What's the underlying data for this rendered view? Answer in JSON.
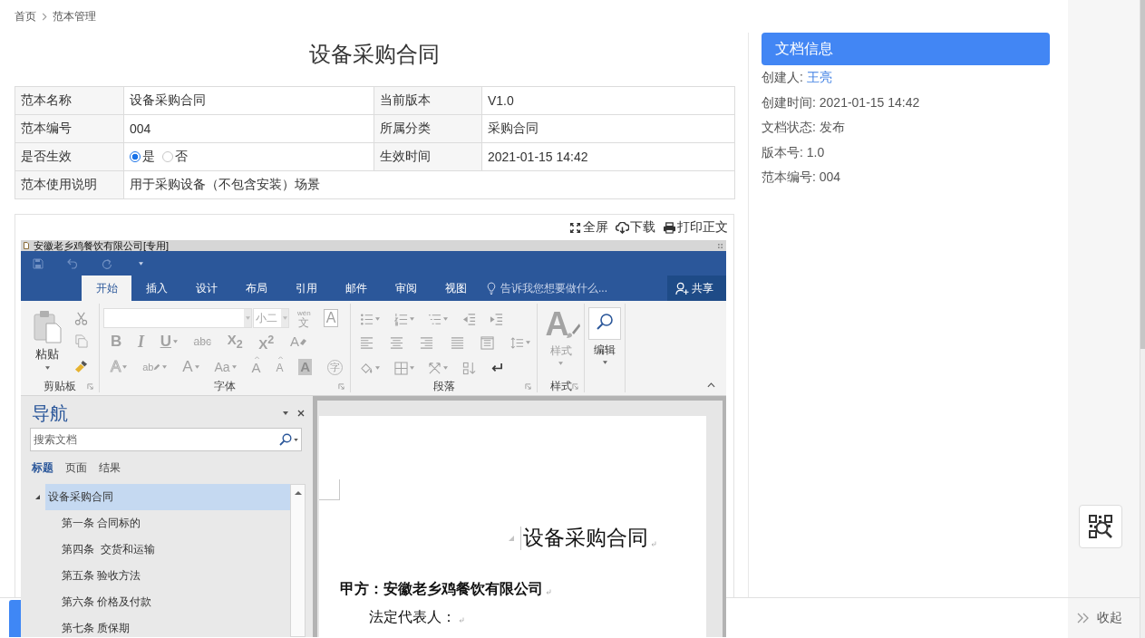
{
  "breadcrumb": [
    {
      "label": "首页"
    },
    {
      "label": "范本管理"
    }
  ],
  "title": "设备采购合同",
  "info_table": {
    "rows": [
      {
        "fields": [
          {
            "kind": "text",
            "label": "范本名称",
            "value": "设备采购合同"
          },
          {
            "kind": "text",
            "label": "当前版本",
            "value": "V1.0"
          }
        ]
      },
      {
        "fields": [
          {
            "kind": "text",
            "label": "范本编号",
            "value": "004"
          },
          {
            "kind": "text",
            "label": "所属分类",
            "value": "采购合同"
          }
        ]
      },
      {
        "fields": [
          {
            "kind": "radio",
            "label": "是否生效",
            "options": [
              {
                "label": "是",
                "selected": true
              },
              {
                "label": "否",
                "selected": false
              }
            ]
          },
          {
            "kind": "text",
            "label": "生效时间",
            "value": "2021-01-15 14:42"
          }
        ]
      },
      {
        "fields": [
          {
            "kind": "text",
            "label": "范本使用说明",
            "value": "用于采购设备（不包含安装）场景"
          }
        ]
      }
    ]
  },
  "viewer": {
    "actions": [
      {
        "kind": "fullscreen",
        "label": "全屏"
      },
      {
        "kind": "download",
        "label": "下载"
      },
      {
        "kind": "print",
        "label": "打印正文"
      }
    ],
    "word": {
      "title": "安徽老乡鸡餐饮有限公司[专用]",
      "tabs": [
        {
          "label": "开始",
          "selected": true
        },
        {
          "label": "插入",
          "selected": false
        },
        {
          "label": "设计",
          "selected": false
        },
        {
          "label": "布局",
          "selected": false
        },
        {
          "label": "引用",
          "selected": false
        },
        {
          "label": "邮件",
          "selected": false
        },
        {
          "label": "审阅",
          "selected": false
        },
        {
          "label": "视图",
          "selected": false
        }
      ],
      "tell_me": {
        "placeholder": "告诉我您想要做什么..."
      },
      "share": "共享",
      "ribbon": {
        "disabled": true,
        "clipboard": {
          "paste": "粘贴",
          "label": "剪贴板"
        },
        "font": {
          "size": "小二",
          "top_tools": [
            {
              "kind": "phonetic",
              "ruby": "wén",
              "text": "文",
              "dropdown": false
            },
            {
              "kind": "boxed",
              "text": "A",
              "dropdown": false
            }
          ],
          "rows": [
            [
              {
                "kind": "bold",
                "text": "B",
                "dropdown": false
              },
              {
                "kind": "italic",
                "text": "I",
                "dropdown": false
              },
              {
                "kind": "underline",
                "text": "U",
                "dropdown": true
              },
              {
                "kind": "strike",
                "text": "abc",
                "dropdown": false
              },
              {
                "kind": "subscript",
                "text": "X$_{2}$",
                "dropdown": false
              },
              {
                "kind": "superscript",
                "text": "X$^{2}$",
                "dropdown": false
              },
              {
                "kind": "eraser",
                "text": "A",
                "dropdown": false
              }
            ],
            [
              {
                "kind": "outline",
                "text": "A",
                "dropdown": true
              },
              {
                "kind": "highlight",
                "text": "ab",
                "dropdown": true
              },
              {
                "kind": "color",
                "text": "A",
                "dropdown": true
              },
              {
                "kind": "case",
                "text": "Aa",
                "dropdown": true
              },
              {
                "kind": "grow",
                "text": "A",
                "dropdown": false
              },
              {
                "kind": "shrink",
                "text": "A",
                "dropdown": false
              },
              {
                "kind": "shaded",
                "text": "A",
                "dropdown": false
              },
              {
                "kind": "circled",
                "text": "字",
                "dropdown": false
              }
            ]
          ],
          "label": "字体"
        },
        "paragraph": {
          "label": "段落"
        },
        "styles": {
          "icon_text": "A",
          "caption": "样式",
          "label": "样式"
        },
        "editing": {
          "caption": "编辑"
        }
      },
      "navigation": {
        "title": "导航",
        "search": {
          "placeholder": "搜索文档"
        },
        "tabs": [
          {
            "label": "标题",
            "selected": true
          },
          {
            "label": "页面",
            "selected": false
          },
          {
            "label": "结果",
            "selected": false
          }
        ],
        "tree": [
          {
            "label": "设备采购合同",
            "selected": true,
            "expanded": true,
            "children": [
              {
                "label": "第一条 合同标的",
                "selected": false
              },
              {
                "label": "第四条  交货和运输",
                "selected": false
              },
              {
                "label": "第五条 验收方法",
                "selected": false
              },
              {
                "label": "第六条 价格及付款",
                "selected": false
              },
              {
                "label": "第七条 质保期",
                "selected": false
              }
            ]
          }
        ]
      },
      "document": {
        "title": "设备采购合同",
        "paragraphs": [
          {
            "kind": "bold",
            "text": "甲方：安徽老乡鸡餐饮有限公司"
          },
          {
            "kind": "indent",
            "text": "法定代表人："
          }
        ]
      }
    }
  },
  "doc_info": {
    "title": "文档信息",
    "fields": [
      {
        "kind": "link",
        "label": "创建人:",
        "value": "王亮"
      },
      {
        "kind": "text",
        "label": "创建时间:",
        "value": "2021-01-15 14:42"
      },
      {
        "kind": "text",
        "label": "文档状态:",
        "value": "发布"
      },
      {
        "kind": "text",
        "label": "版本号:",
        "value": "1.0"
      },
      {
        "kind": "text",
        "label": "范本编号:",
        "value": "004"
      }
    ]
  },
  "collapse": {
    "label": "收起"
  }
}
